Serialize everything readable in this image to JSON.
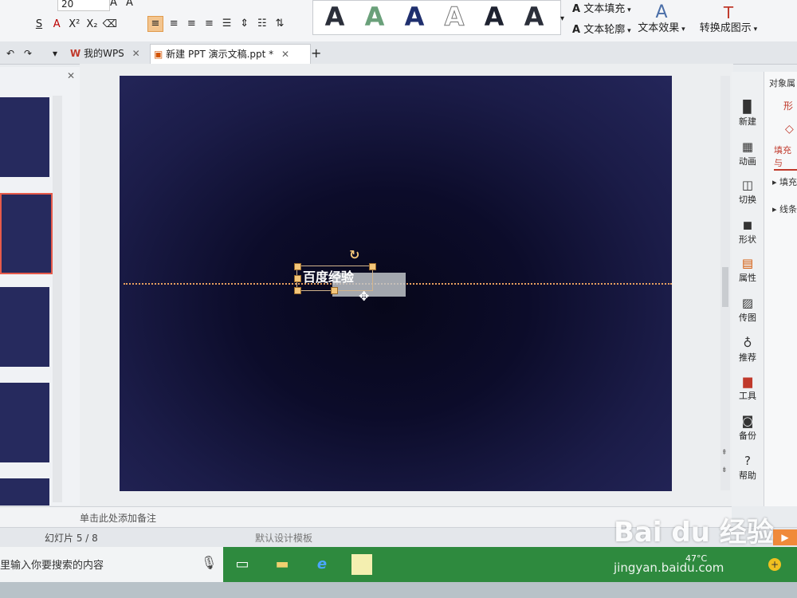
{
  "ribbon": {
    "font_size": "20",
    "text_fill_label": "文本填充",
    "text_outline_label": "文本轮廓",
    "text_effect_label": "文本效果",
    "convert_smartart_label": "转换成图示"
  },
  "tabs": [
    {
      "label": "我的WPS"
    },
    {
      "label": "新建 PPT 演示文稿.ppt *"
    }
  ],
  "slide": {
    "text": "百度经验"
  },
  "right_tools": [
    {
      "label": "新建",
      "icon": "new-icon"
    },
    {
      "label": "动画",
      "icon": "animation-icon"
    },
    {
      "label": "切换",
      "icon": "transition-icon"
    },
    {
      "label": "形状",
      "icon": "shape-icon"
    },
    {
      "label": "属性",
      "icon": "property-icon"
    },
    {
      "label": "传图",
      "icon": "upload-image-icon"
    },
    {
      "label": "推荐",
      "icon": "recommend-icon"
    },
    {
      "label": "工具",
      "icon": "toolbox-icon"
    },
    {
      "label": "备份",
      "icon": "backup-icon"
    },
    {
      "label": "帮助",
      "icon": "help-icon"
    }
  ],
  "props_panel": {
    "title": "对象属",
    "tab_shape": "形",
    "tab_fill": "填充与",
    "section_fill": "填充",
    "section_line": "线条"
  },
  "notes": {
    "placeholder": "单击此处添加备注"
  },
  "status": {
    "slide_count": "幻灯片 5 / 8",
    "template": "默认设计模板"
  },
  "taskbar": {
    "search_placeholder": "里输入你要搜索的内容",
    "temperature": "47°C"
  },
  "watermark": {
    "logo_text": "Bai du 经验",
    "url": "jingyan.baidu.com"
  },
  "colors": {
    "slide_bg": "#1b1c46",
    "taskbar_green": "#2e8a3e",
    "guide_line": "#e8a060"
  }
}
